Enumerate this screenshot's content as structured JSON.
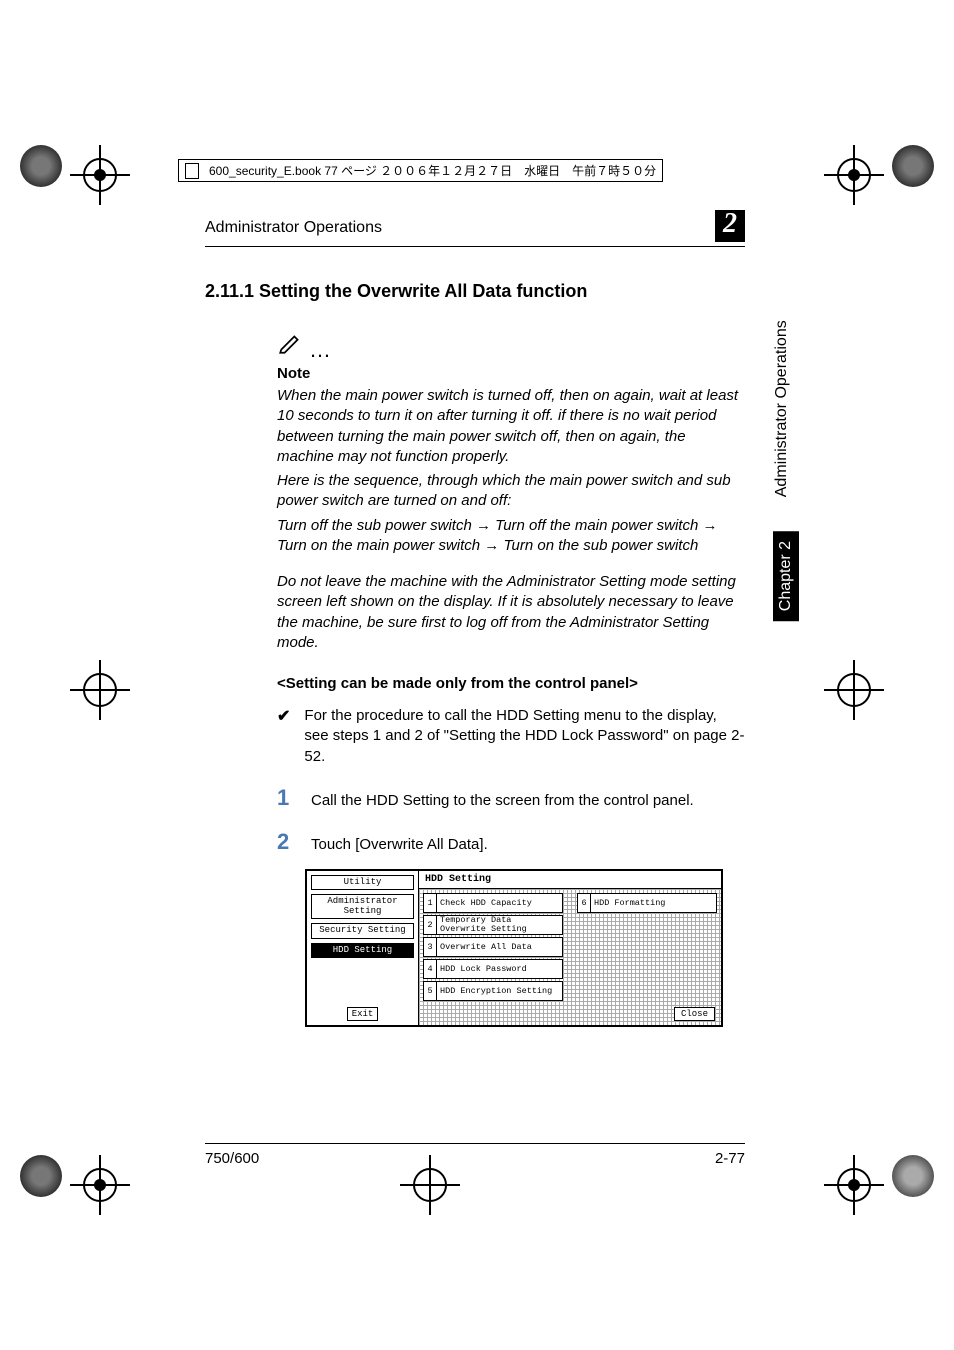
{
  "meta": {
    "filename": "600_security_E.book  77 ページ  ２００６年１２月２７日　水曜日　午前７時５０分"
  },
  "header": {
    "running": "Administrator Operations",
    "chapno": "2"
  },
  "side": {
    "chapter": "Chapter 2",
    "title": "Administrator Operations"
  },
  "heading": "2.11.1  Setting the Overwrite All Data function",
  "note": {
    "label": "Note",
    "p1": "When the main power switch is turned off, then on again, wait at least 10 seconds to turn it on after turning it off. if there is no wait period between turning the main power switch off, then on again, the machine may not function properly.",
    "p2": "Here is the sequence, through which the main power switch and sub power switch are turned on and off:",
    "p3": "Turn off the sub power switch → Turn off the main power switch → Turn on the main power switch → Turn on the sub power switch",
    "p4": "Do not leave the machine with the Administrator Setting mode setting screen left shown on the display. If it is absolutely necessary to leave the machine, be sure first to log off from the Administrator Setting mode."
  },
  "subhead": "<Setting can be made only from the control panel>",
  "bullet": "For the procedure to call the HDD Setting menu to the display, see steps 1 and 2 of \"Setting the HDD Lock Password\" on page 2-52.",
  "steps": {
    "s1": "Call the HDD Setting to the screen from the control panel.",
    "s2": "Touch [Overwrite All Data]."
  },
  "screenshot": {
    "left": {
      "utility": "Utility",
      "admin": "Administrator Setting",
      "security": "Security Setting",
      "hdd": "HDD Setting",
      "exit": "Exit"
    },
    "right": {
      "title": "HDD Setting",
      "items": [
        {
          "n": "1",
          "t": "Check HDD Capacity"
        },
        {
          "n": "2",
          "t": "Temporary Data Overwrite Setting"
        },
        {
          "n": "3",
          "t": "Overwrite All Data"
        },
        {
          "n": "4",
          "t": "HDD Lock Password"
        },
        {
          "n": "5",
          "t": "HDD Encryption Setting"
        },
        {
          "n": "6",
          "t": "HDD Formatting"
        }
      ],
      "close": "Close"
    }
  },
  "footer": {
    "left": "750/600",
    "right": "2-77"
  }
}
